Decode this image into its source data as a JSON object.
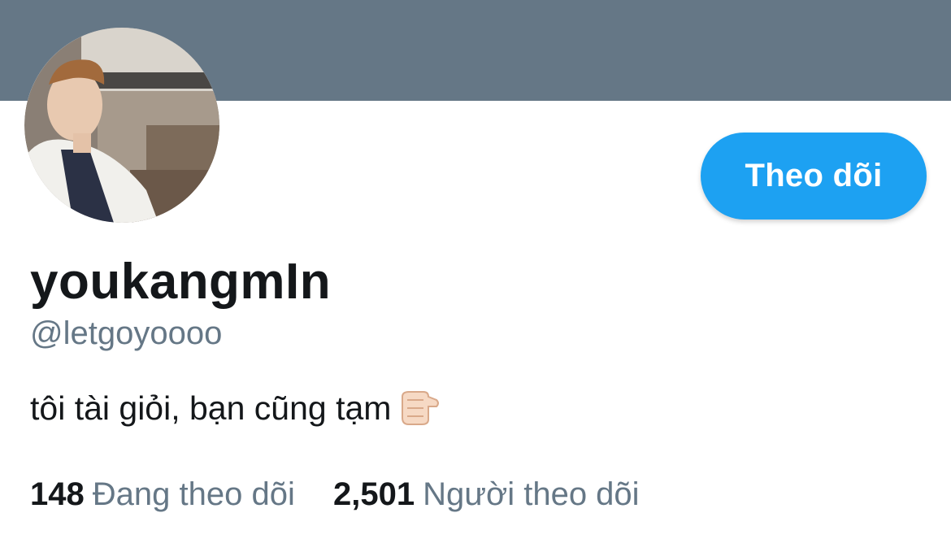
{
  "profile": {
    "display_name": "youkangmIn",
    "handle": "@letgoyoooo",
    "bio": "tôi tài giỏi, bạn cũng tạm",
    "bio_emoji": "pointing-finger-emoji"
  },
  "actions": {
    "follow_label": "Theo dõi"
  },
  "stats": {
    "following_count": "148",
    "following_label": "Đang theo dõi",
    "followers_count": "2,501",
    "followers_label": "Người theo dõi"
  },
  "colors": {
    "banner": "#657786",
    "accent": "#1da1f2",
    "text_primary": "#14171a",
    "text_secondary": "#657786"
  }
}
